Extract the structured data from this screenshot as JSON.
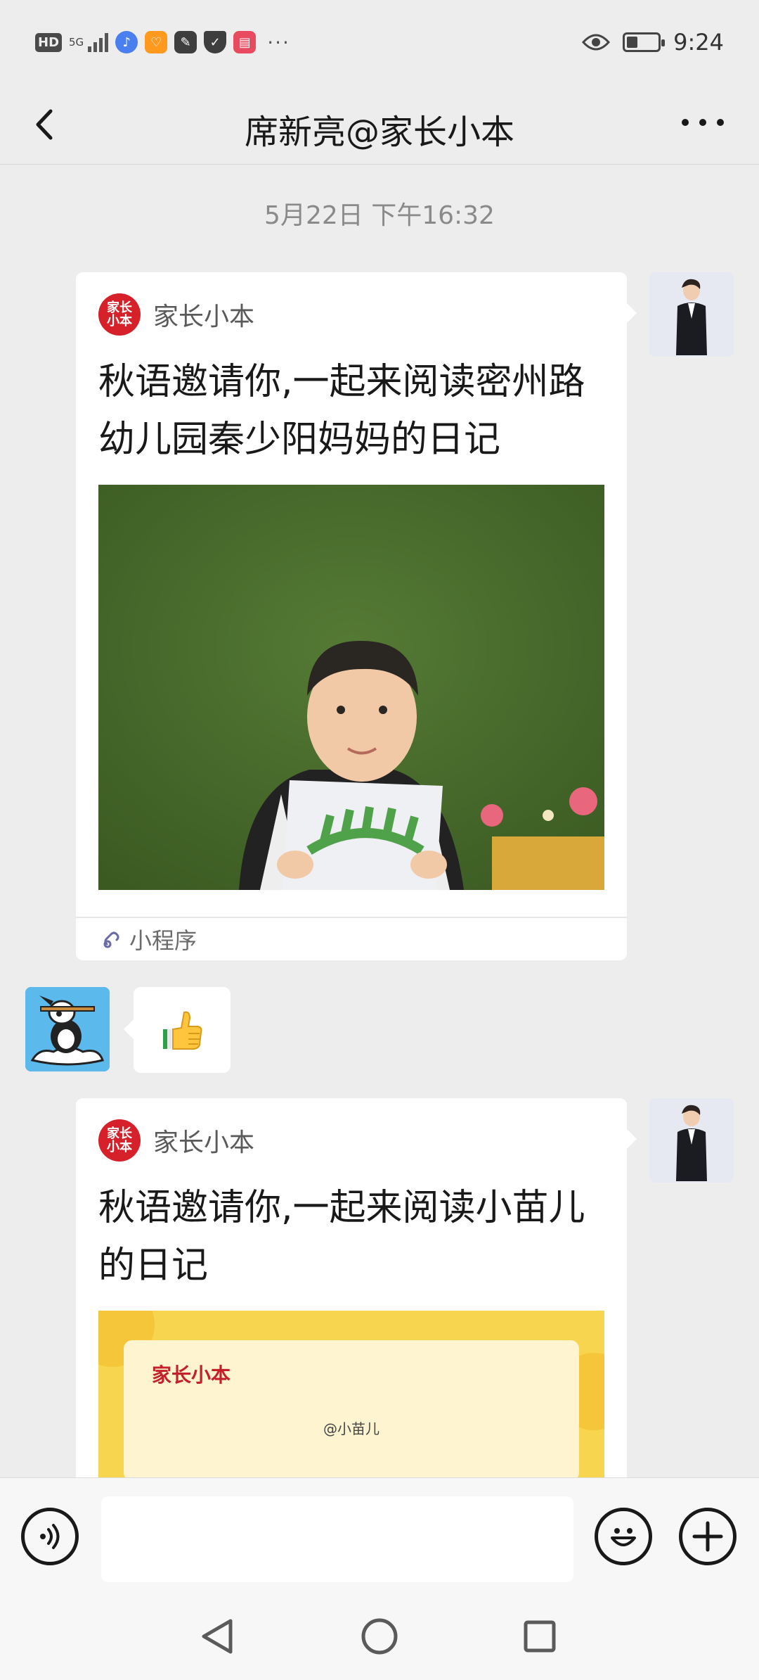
{
  "status_bar": {
    "hd": "HD",
    "network": "5G",
    "time": "9:24",
    "battery_level": 0.35,
    "app_icons": [
      "music-icon",
      "heart-app-icon",
      "pen-app-icon",
      "shield-icon",
      "book-app-icon"
    ],
    "more": "···"
  },
  "nav": {
    "title": "席新亮@家长小本"
  },
  "chat": {
    "timestamp": "5月22日 下午16:32",
    "messages": [
      {
        "type": "mini_program_card",
        "from": "self",
        "brand_logo": "家长小本",
        "brand_name": "家长小本",
        "title": "秋语邀请你,一起来阅读密州路幼儿园秦少阳妈妈的日记",
        "footer_label": "小程序"
      },
      {
        "type": "emoji",
        "from": "other",
        "emoji": "👍"
      },
      {
        "type": "mini_program_card",
        "from": "self",
        "brand_logo": "家长小本",
        "brand_name": "家长小本",
        "title": "秋语邀请你,一起来阅读小苗儿的日记",
        "image_brand": "家长小本",
        "image_user": "@小苗儿"
      }
    ]
  },
  "colors": {
    "background": "#ededed",
    "brand_red": "#d6202a",
    "grass_green": "#4a6b2c",
    "diary_yellow": "#f8d54e"
  }
}
